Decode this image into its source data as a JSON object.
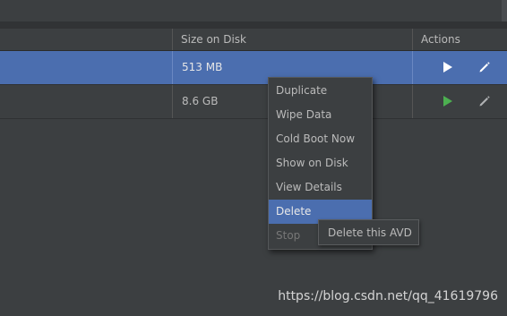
{
  "table": {
    "headers": {
      "size": "Size on Disk",
      "actions": "Actions"
    },
    "rows": [
      {
        "name": "",
        "size": "513 MB",
        "selected": true
      },
      {
        "name": "",
        "size": "8.6 GB",
        "selected": false
      }
    ]
  },
  "context_menu": {
    "items": [
      {
        "label": "Duplicate"
      },
      {
        "label": "Wipe Data"
      },
      {
        "label": "Cold Boot Now"
      },
      {
        "label": "Show on Disk"
      },
      {
        "label": "View Details"
      },
      {
        "label": "Delete"
      },
      {
        "label": "Stop"
      }
    ],
    "highlighted": "Delete",
    "disabled": [
      "Stop"
    ]
  },
  "tooltip": {
    "text": "Delete this AVD"
  },
  "watermark": "https://blog.csdn.net/qq_41619796",
  "icons": {
    "play": "play-icon",
    "edit": "pencil-icon"
  },
  "colors": {
    "selection": "#4b6eaf",
    "play_white": "#ffffff",
    "play_green": "#4caf50",
    "background": "#3c3f41"
  }
}
